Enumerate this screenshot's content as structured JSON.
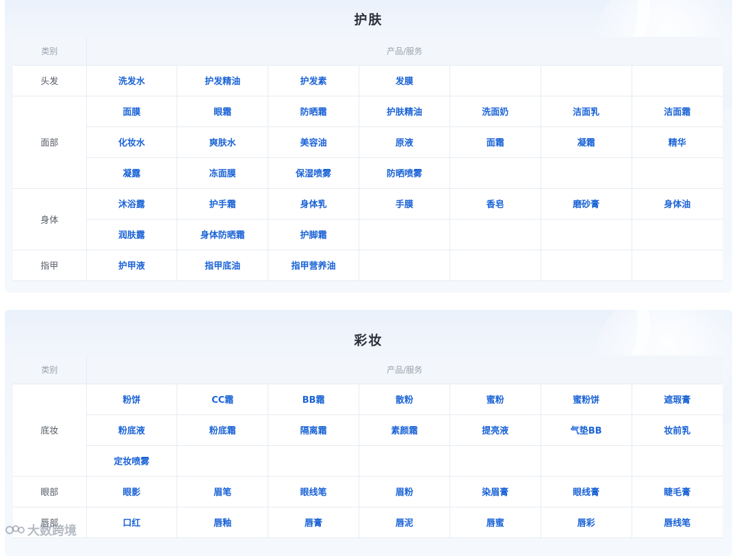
{
  "skin": {
    "title": "护肤",
    "header": {
      "category": "类别",
      "products": "产品/服务"
    },
    "groups": [
      {
        "category": "头发",
        "rows": [
          [
            "洗发水",
            "护发精油",
            "护发素",
            "发膜",
            "",
            "",
            ""
          ]
        ]
      },
      {
        "category": "面部",
        "rows": [
          [
            "面膜",
            "眼霜",
            "防晒霜",
            "护肤精油",
            "洗面奶",
            "洁面乳",
            "洁面霜"
          ],
          [
            "化妆水",
            "爽肤水",
            "美容油",
            "原液",
            "面霜",
            "凝霜",
            "精华"
          ],
          [
            "凝露",
            "冻面膜",
            "保湿喷雾",
            "防晒喷雾",
            "",
            "",
            ""
          ]
        ]
      },
      {
        "category": "身体",
        "rows": [
          [
            "沐浴露",
            "护手霜",
            "身体乳",
            "手膜",
            "香皂",
            "磨砂膏",
            "身体油"
          ],
          [
            "润肤露",
            "身体防晒霜",
            "护脚霜",
            "",
            "",
            "",
            ""
          ]
        ]
      },
      {
        "category": "指甲",
        "rows": [
          [
            "护甲液",
            "指甲底油",
            "指甲营养油",
            "",
            "",
            "",
            ""
          ]
        ]
      }
    ]
  },
  "makeup": {
    "title": "彩妆",
    "header": {
      "category": "类别",
      "products": "产品/服务"
    },
    "groups": [
      {
        "category": "底妆",
        "rows": [
          [
            "粉饼",
            "CC霜",
            "BB霜",
            "散粉",
            "蜜粉",
            "蜜粉饼",
            "遮瑕膏"
          ],
          [
            "粉底液",
            "粉底霜",
            "隔离霜",
            "素颜霜",
            "提亮液",
            "气垫BB",
            "妆前乳"
          ],
          [
            "定妆喷雾",
            "",
            "",
            "",
            "",
            "",
            ""
          ]
        ]
      },
      {
        "category": "眼部",
        "rows": [
          [
            "眼影",
            "眉笔",
            "眼线笔",
            "眉粉",
            "染眉膏",
            "眼线膏",
            "睫毛膏"
          ]
        ]
      },
      {
        "category": "唇部",
        "rows": [
          [
            "口红",
            "唇釉",
            "唇膏",
            "唇泥",
            "唇蜜",
            "唇彩",
            "唇线笔"
          ]
        ]
      }
    ]
  },
  "watermark": {
    "text": "大数跨境"
  }
}
